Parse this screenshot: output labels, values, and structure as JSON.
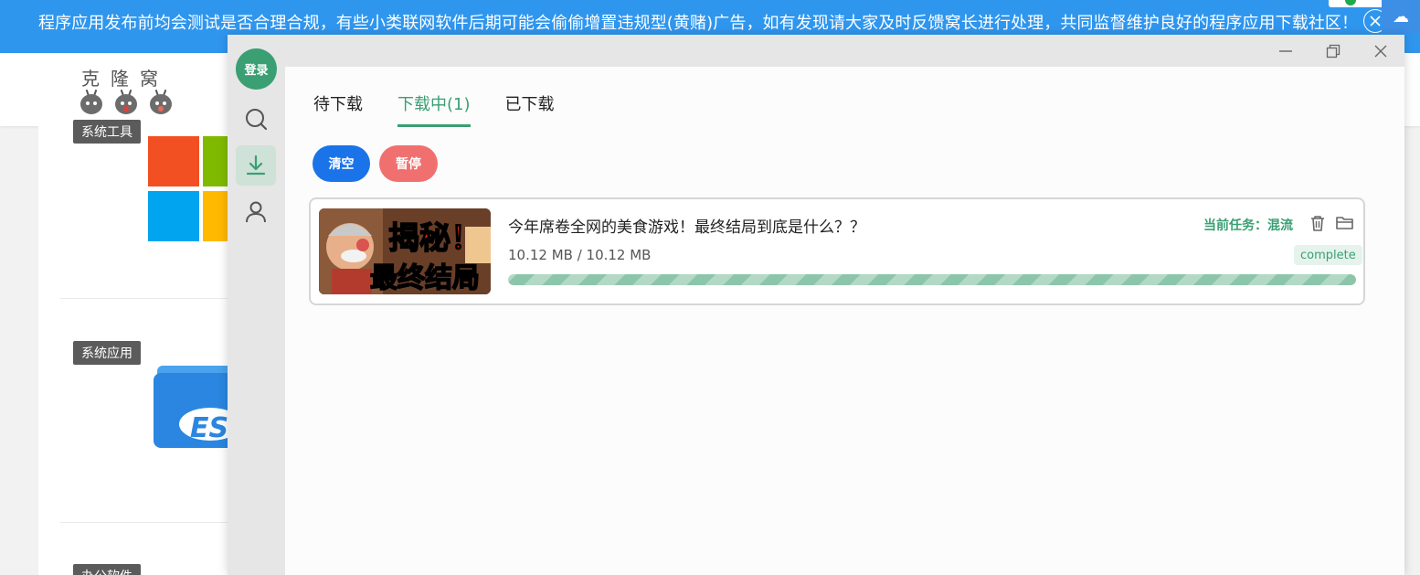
{
  "banner": {
    "text": "程序应用发布前均会测试是否合理合规，有些小类联网软件后期可能会偷偷增置违规型(黄赌)广告，如有发现请大家及时反馈窝长进行处理，共同监督维护良好的程序应用下载社区！",
    "close_icon": "close-circle-icon"
  },
  "site": {
    "logo_text": "克隆窝",
    "categories": [
      "系统工具",
      "系统应用",
      "办公软件"
    ]
  },
  "window": {
    "controls": [
      "minimize-icon",
      "restore-icon",
      "close-icon"
    ]
  },
  "sidebar": {
    "login_label": "登录",
    "icons": [
      "search-icon",
      "download-icon",
      "user-icon"
    ]
  },
  "tabs": [
    {
      "label": "待下载",
      "active": false
    },
    {
      "label": "下载中(1)",
      "active": true
    },
    {
      "label": "已下载",
      "active": false
    }
  ],
  "actions": {
    "clear_label": "清空",
    "pause_label": "暂停"
  },
  "task": {
    "title": "今年席卷全网的美食游戏！最终结局到底是什么？？",
    "size": "10.12 MB / 10.12 MB",
    "current_task": "当前任务：混流",
    "status": "complete",
    "progress": 1.0,
    "thumb_text_top": "揭秘！",
    "thumb_text_bottom": "最终结局"
  },
  "colors": {
    "accent": "#3a9f73",
    "banner": "#2f96ee",
    "clear": "#1a73e8",
    "pause": "#f07070"
  }
}
